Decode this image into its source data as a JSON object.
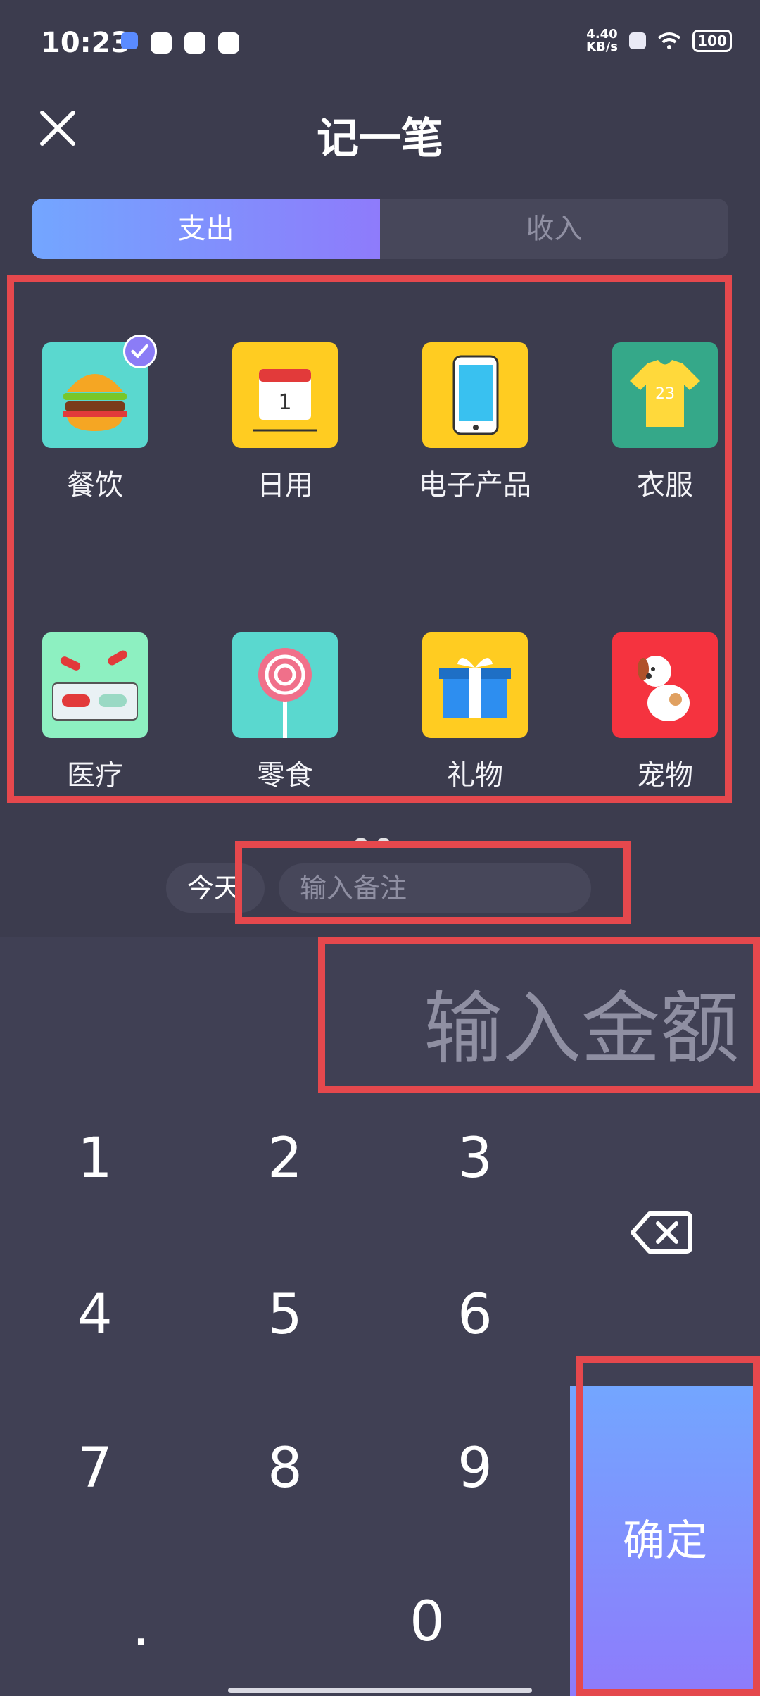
{
  "status_bar": {
    "time": "10:23",
    "net_speed_value": "4.40",
    "net_speed_unit": "KB/s",
    "battery": "100"
  },
  "header": {
    "title": "记一笔"
  },
  "tabs": [
    {
      "label": "支出"
    },
    {
      "label": "收入"
    }
  ],
  "categories": [
    {
      "label": "餐饮",
      "icon": "burger-icon",
      "selected": true,
      "color": "#5ad8cf"
    },
    {
      "label": "日用",
      "icon": "calendar-icon",
      "selected": false,
      "color": "#ffcc21"
    },
    {
      "label": "电子产品",
      "icon": "phone-icon",
      "selected": false,
      "color": "#ffcc21"
    },
    {
      "label": "衣服",
      "icon": "tshirt-icon",
      "selected": false,
      "color": "#35a889"
    },
    {
      "label": "医疗",
      "icon": "pills-icon",
      "selected": false,
      "color": "#8df0c1"
    },
    {
      "label": "零食",
      "icon": "lollipop-icon",
      "selected": false,
      "color": "#5ad8cf"
    },
    {
      "label": "礼物",
      "icon": "gift-icon",
      "selected": false,
      "color": "#ffcc21"
    },
    {
      "label": "宠物",
      "icon": "dog-icon",
      "selected": false,
      "color": "#f5333f"
    }
  ],
  "note": {
    "date_label": "今天",
    "placeholder": "输入备注"
  },
  "amount": {
    "placeholder": "输入金额"
  },
  "keypad": {
    "keys": [
      "1",
      "2",
      "3",
      "4",
      "5",
      "6",
      "7",
      "8",
      "9",
      ".",
      "0"
    ],
    "confirm_label": "确定"
  },
  "colors": {
    "accent_start": "#73a6ff",
    "accent_end": "#8e7bfb",
    "highlight_frame": "#e5484d"
  }
}
